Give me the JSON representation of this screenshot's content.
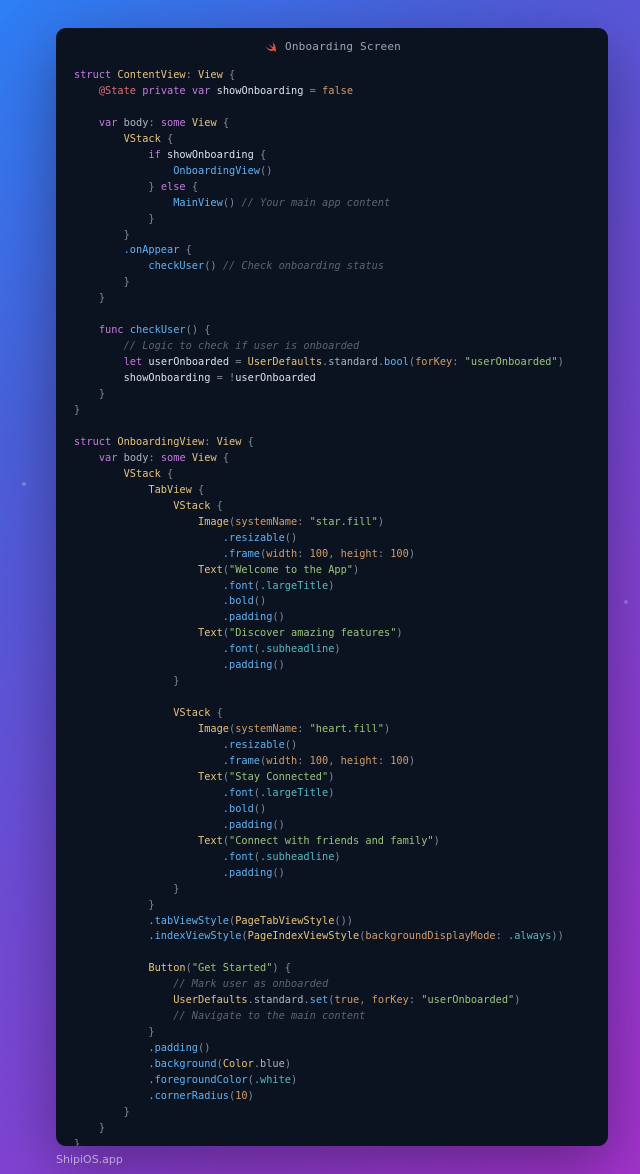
{
  "title": "Onboarding Screen",
  "watermark": "ShipiOS.app",
  "code": {
    "struct1_name": "ContentView",
    "view": "View",
    "state": "@State",
    "private": "private",
    "var": "var",
    "show_prop": "showOnboarding",
    "eq": "=",
    "false": "false",
    "body": "body",
    "some": "some",
    "vstack": "VStack",
    "if": "if",
    "else": "else",
    "onb_view_call": "OnboardingView",
    "main_view_call": "MainView",
    "cmt_main": "// Your main app content",
    "on_appear": ".onAppear",
    "check_user_call": "checkUser",
    "cmt_check": "// Check onboarding status",
    "func": "func",
    "check_user_name": "checkUser",
    "cmt_logic": "// Logic to check if user is onboarded",
    "let": "let",
    "user_onboarded_var": "userOnboarded",
    "userdefaults": "UserDefaults",
    "standard": "standard",
    "bool_m": "bool",
    "forkey": "forKey",
    "key_user": "\"userOnboarded\"",
    "bang": "!",
    "struct2_name": "OnboardingView",
    "tabview": "TabView",
    "image": "Image",
    "systemname": "systemName",
    "star_fill": "\"star.fill\"",
    "heart_fill": "\"heart.fill\"",
    "resizable": ".resizable",
    "frame": ".frame",
    "width": "width",
    "height": "height",
    "hundred": "100",
    "text": "Text",
    "str_welcome": "\"Welcome to the App\"",
    "str_discover": "\"Discover amazing features\"",
    "str_stay": "\"Stay Connected\"",
    "str_connect": "\"Connect with friends and family\"",
    "font": ".font",
    "large_title": ".largeTitle",
    "subheadline": ".subheadline",
    "bold": ".bold",
    "padding": ".padding",
    "tabviewstyle": ".tabViewStyle",
    "pagetabviewstyle": "PageTabViewStyle",
    "indexviewstyle": ".indexViewStyle",
    "pageindexviewstyle": "PageIndexViewStyle",
    "bg_display": "backgroundDisplayMode",
    "always": ".always",
    "button": "Button",
    "get_started": "\"Get Started\"",
    "cmt_mark": "// Mark user as onboarded",
    "set": "set",
    "true": "true",
    "cmt_nav": "// Navigate to the main content",
    "background": ".background",
    "color": "Color",
    "blue": "blue",
    "fg": ".foregroundColor",
    "white_enum": ".white",
    "corner": ".cornerRadius",
    "ten": "10",
    "struct": "struct"
  }
}
